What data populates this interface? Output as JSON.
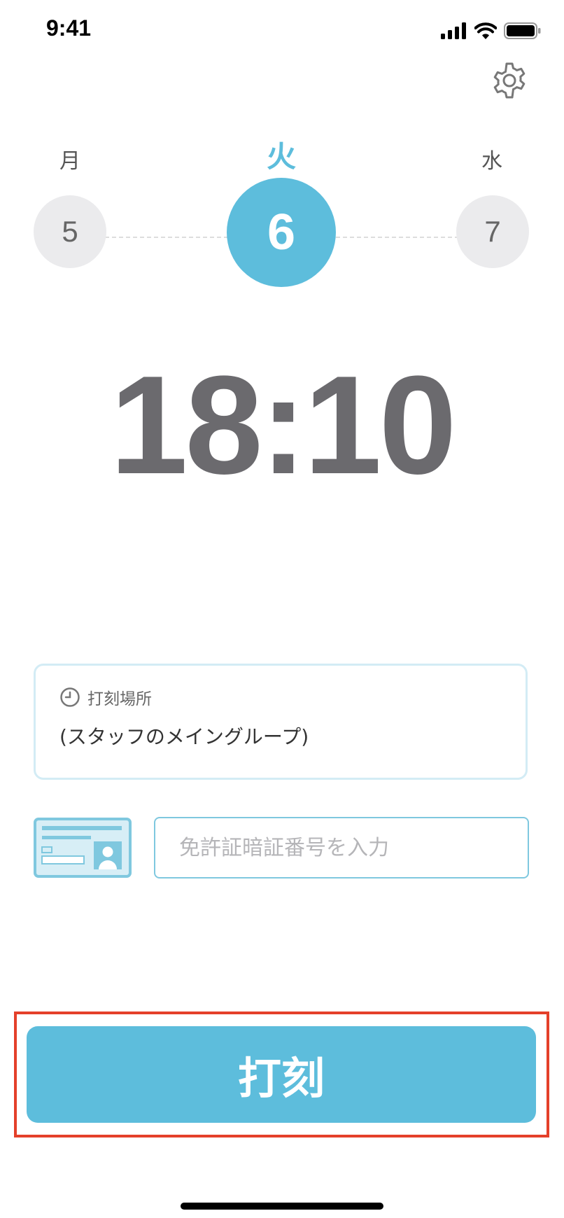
{
  "status_bar": {
    "time": "9:41"
  },
  "week": {
    "days": [
      {
        "dow": "月",
        "date": "5"
      },
      {
        "dow": "火",
        "date": "6"
      },
      {
        "dow": "水",
        "date": "7"
      }
    ]
  },
  "clock": {
    "time": "18:10"
  },
  "location": {
    "label": "打刻場所",
    "value": "(スタッフのメイングループ)"
  },
  "license": {
    "placeholder": "免許証暗証番号を入力",
    "value": ""
  },
  "stamp_button": {
    "label": "打刻"
  },
  "colors": {
    "accent": "#5dbddc",
    "highlight": "#e4402a",
    "clock_text": "#6b6a6e"
  },
  "icons": [
    "signal-icon",
    "wifi-icon",
    "battery-icon",
    "gear-icon",
    "clock-icon",
    "license-card-icon"
  ]
}
